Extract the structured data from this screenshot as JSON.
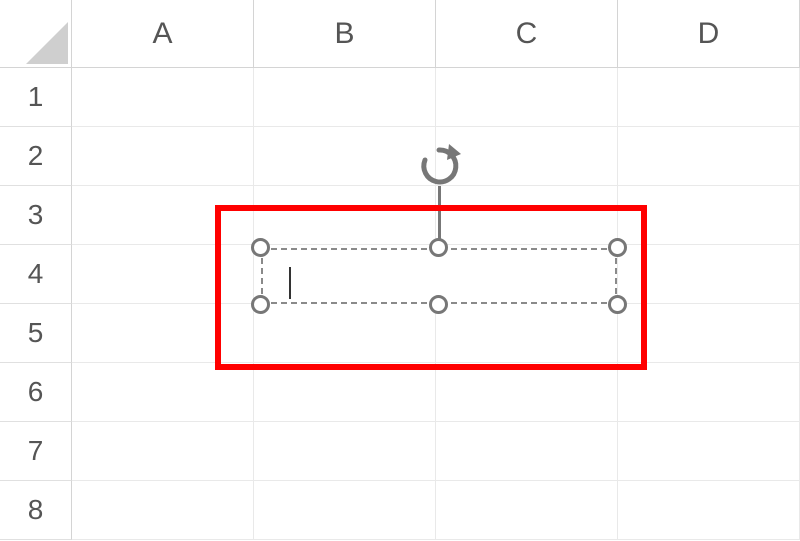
{
  "columns": [
    "A",
    "B",
    "C",
    "D"
  ],
  "rows": [
    "1",
    "2",
    "3",
    "4",
    "5",
    "6",
    "7",
    "8"
  ],
  "textbox": {
    "content": ""
  },
  "colors": {
    "highlight": "#ff0000",
    "handle_border": "#777777"
  }
}
